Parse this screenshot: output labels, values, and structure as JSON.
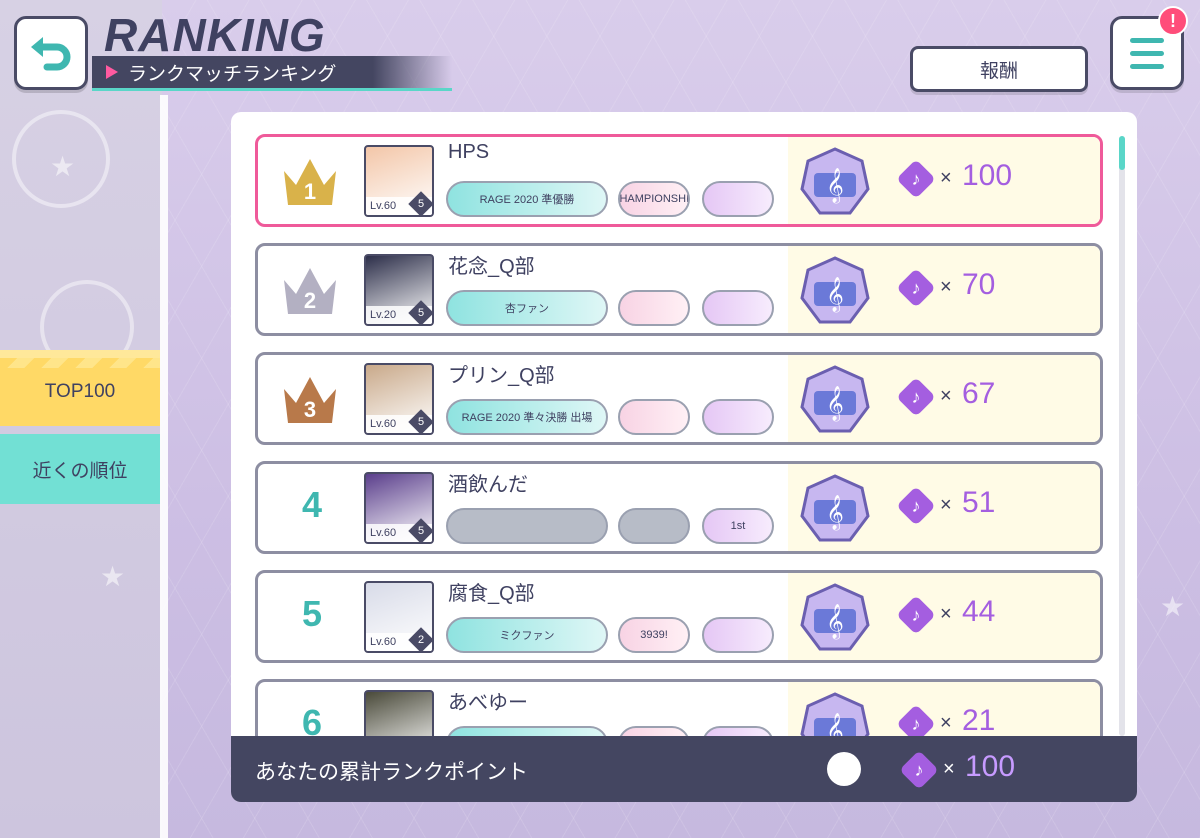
{
  "header": {
    "title": "RANKING",
    "subtitle": "ランクマッチランキング",
    "reward_label": "報酬",
    "menu_badge": "!"
  },
  "tabs": [
    {
      "label": "TOP100",
      "active": true,
      "color": "#ffd966"
    },
    {
      "label": "近くの順位",
      "active": false,
      "color": "#72e0d4"
    }
  ],
  "rows": [
    {
      "rank": "1",
      "name": "HPS",
      "level": "Lv.60",
      "master_rank": "5",
      "points": "100",
      "badges": [
        "RAGE 2020 準優勝",
        "CHAMPIONSHIP",
        ""
      ],
      "crown": "gold"
    },
    {
      "rank": "2",
      "name": "花念_Q部",
      "level": "Lv.20",
      "master_rank": "5",
      "points": "70",
      "badges": [
        "杏ファン",
        "",
        ""
      ],
      "crown": "silver"
    },
    {
      "rank": "3",
      "name": "プリン_Q部",
      "level": "Lv.60",
      "master_rank": "5",
      "points": "67",
      "badges": [
        "RAGE 2020 準々決勝 出場",
        "",
        ""
      ],
      "crown": "bronze"
    },
    {
      "rank": "4",
      "name": "酒飲んだ",
      "level": "Lv.60",
      "master_rank": "5",
      "points": "51",
      "badges": [
        "",
        "",
        "1st"
      ],
      "crown": ""
    },
    {
      "rank": "5",
      "name": "腐食_Q部",
      "level": "Lv.60",
      "master_rank": "2",
      "points": "44",
      "badges": [
        "ミクファン",
        "3939!",
        ""
      ],
      "crown": ""
    },
    {
      "rank": "6",
      "name": "あべゆー",
      "level": "",
      "master_rank": "",
      "points": "21",
      "badges": [
        "",
        "",
        ""
      ],
      "crown": ""
    }
  ],
  "footer": {
    "label": "あなたの累計ランクポイント",
    "multiply": "×",
    "points": "100"
  },
  "multiply_sign": "×",
  "colors": {
    "accent_teal": "#5ad6c8",
    "accent_pink": "#ef5a9a",
    "point_purple": "#a45ee0",
    "dark": "#444661"
  }
}
